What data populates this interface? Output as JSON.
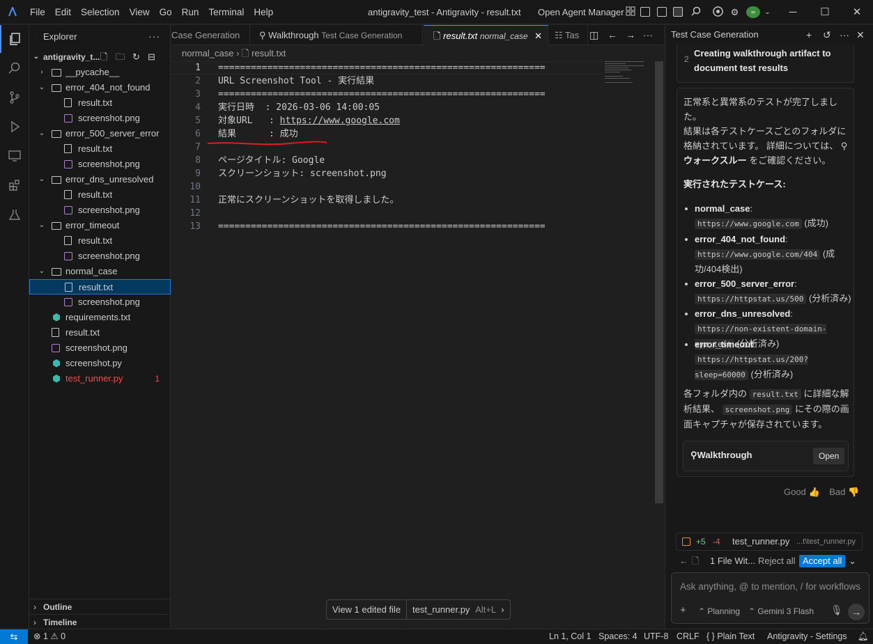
{
  "titlebar": {
    "menu": [
      "File",
      "Edit",
      "Selection",
      "View",
      "Go",
      "Run",
      "Terminal",
      "Help"
    ],
    "window_title": "antigravity_test - Antigravity - result.txt",
    "agent_manager": "Open Agent Manager"
  },
  "sidebar": {
    "title": "Explorer",
    "root": "antigravity_t...",
    "tree": [
      {
        "label": "__pycache__",
        "kind": "folder",
        "depth": 1,
        "expanded": false
      },
      {
        "label": "error_404_not_found",
        "kind": "folder",
        "depth": 1,
        "expanded": true
      },
      {
        "label": "result.txt",
        "kind": "file",
        "depth": 2
      },
      {
        "label": "screenshot.png",
        "kind": "image",
        "depth": 2
      },
      {
        "label": "error_500_server_error",
        "kind": "folder",
        "depth": 1,
        "expanded": true
      },
      {
        "label": "result.txt",
        "kind": "file",
        "depth": 2
      },
      {
        "label": "screenshot.png",
        "kind": "image",
        "depth": 2
      },
      {
        "label": "error_dns_unresolved",
        "kind": "folder",
        "depth": 1,
        "expanded": true
      },
      {
        "label": "result.txt",
        "kind": "file",
        "depth": 2
      },
      {
        "label": "screenshot.png",
        "kind": "image",
        "depth": 2
      },
      {
        "label": "error_timeout",
        "kind": "folder",
        "depth": 1,
        "expanded": true
      },
      {
        "label": "result.txt",
        "kind": "file",
        "depth": 2
      },
      {
        "label": "screenshot.png",
        "kind": "image",
        "depth": 2
      },
      {
        "label": "normal_case",
        "kind": "folder",
        "depth": 1,
        "expanded": true
      },
      {
        "label": "result.txt",
        "kind": "file",
        "depth": 2,
        "selected": true
      },
      {
        "label": "screenshot.png",
        "kind": "image",
        "depth": 2
      },
      {
        "label": "requirements.txt",
        "kind": "python",
        "depth": 1
      },
      {
        "label": "result.txt",
        "kind": "file",
        "depth": 1
      },
      {
        "label": "screenshot.png",
        "kind": "image",
        "depth": 1
      },
      {
        "label": "screenshot.py",
        "kind": "python",
        "depth": 1
      },
      {
        "label": "test_runner.py",
        "kind": "python",
        "depth": 1,
        "error": true,
        "badge": "1"
      }
    ],
    "outline": "Outline",
    "timeline": "Timeline"
  },
  "tabs": [
    {
      "label": "Case Generation",
      "sub": ""
    },
    {
      "label": "Walkthrough",
      "sub": "Test Case Generation"
    },
    {
      "label": "result.txt",
      "sub": "normal_case",
      "active": true
    },
    {
      "label": "Tas",
      "sub": ""
    }
  ],
  "breadcrumb": {
    "folder": "normal_case",
    "file": "result.txt"
  },
  "editor": {
    "lines": [
      "============================================================",
      "URL Screenshot Tool - 実行結果",
      "============================================================",
      "実行日時  : 2026-03-06 14:00:05",
      "対象URL   : https://www.google.com",
      "結果      : 成功",
      "",
      "ページタイトル: Google",
      "スクリーンショット: screenshot.png",
      "",
      "正常にスクリーンショットを取得しました。",
      "",
      "============================================================"
    ],
    "current_line": 1
  },
  "edited_bar": {
    "view": "View 1 edited file",
    "file": "test_runner.py",
    "shortcut": "Alt+L"
  },
  "panel": {
    "title": "Test Case Generation",
    "step_number": "2",
    "step_text": "Creating walkthrough artifact to document test results",
    "intro1": "正常系と異常系のテストが完了しました。",
    "intro2": "結果は各テストケースごとのフォルダに格納されています。 詳細については、",
    "intro_link": "ウォークスルー",
    "intro3": " をご確認ください。",
    "heading": "実行されたテストケース:",
    "cases": [
      {
        "name": "normal_case",
        "url": "https://www.google.com",
        "note": "(成功)"
      },
      {
        "name": "error_404_not_found",
        "url": "https://www.google.com/404",
        "note": "(成功/404検出)"
      },
      {
        "name": "error_500_server_error",
        "url": "https://httpstat.us/500",
        "note": "(分析済み)"
      },
      {
        "name": "error_dns_unresolved",
        "url": "https://non-existent-domain-xyz.test",
        "note": "(分析済み)"
      },
      {
        "name": "error_timeout",
        "url": "https://httpstat.us/200?sleep=60000",
        "note": "(分析済み)"
      }
    ],
    "outro_a": "各フォルダ内の",
    "outro_code1": "result.txt",
    "outro_b": "に詳細な解析結果、",
    "outro_code2": "screenshot.png",
    "outro_c": "にその際の画面キャプチャが保存されています。",
    "walkthrough_label": "Walkthrough",
    "walkthrough_open": "Open",
    "good": "Good",
    "bad": "Bad",
    "diff_add": "+5",
    "diff_del": "-4",
    "diff_file": "test_runner.py",
    "diff_path": "...t\\test_runner.py",
    "files_label": "1 File Wit...",
    "reject_all": "Reject all",
    "accept_all": "Accept all",
    "input_placeholder": "Ask anything, @ to mention, / for workflows",
    "mode": "Planning",
    "model": "Gemini 3 Flash"
  },
  "statusbar": {
    "problems_errors": "1",
    "problems_warnings": "0",
    "position": "Ln 1, Col 1",
    "spaces": "Spaces: 4",
    "encoding": "UTF-8",
    "eol": "CRLF",
    "language": "Plain Text",
    "settings": "Antigravity - Settings"
  }
}
